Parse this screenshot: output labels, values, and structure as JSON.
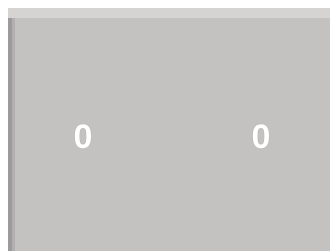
{
  "scoreboard": {
    "left_score": "0",
    "right_score": "0"
  },
  "colors": {
    "panel": "#c4c1c1",
    "panel_top_edge": "#d6d3d3",
    "panel_left_edge": "#9c9a9a",
    "score_text": "#ffffff"
  }
}
